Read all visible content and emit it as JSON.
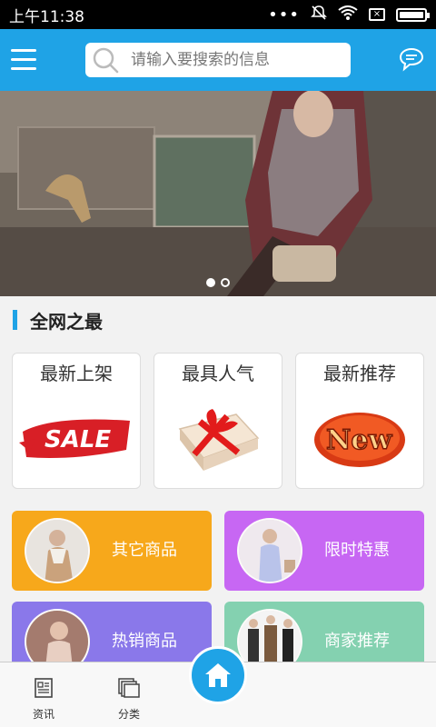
{
  "status_bar": {
    "time": "上午11:38",
    "icons": [
      "dots-icon",
      "mute-icon",
      "wifi-icon",
      "sim-box-icon",
      "battery-icon"
    ]
  },
  "header": {
    "menu_icon": "hamburger-icon",
    "search_placeholder": "请输入要搜索的信息",
    "message_icon": "chat-bubble-icon",
    "accent_color": "#1fa3e6"
  },
  "banner": {
    "slide_count": 2,
    "active_slide": 1
  },
  "section": {
    "title": "全网之最"
  },
  "features": [
    {
      "label": "最新上架",
      "art": "SALE"
    },
    {
      "label": "最具人气",
      "art": "gift-box-icon"
    },
    {
      "label": "最新推荐",
      "art": "New"
    }
  ],
  "categories": [
    {
      "label": "其它商品",
      "color": "#f7a81b"
    },
    {
      "label": "限时特惠",
      "color": "#c767f3"
    },
    {
      "label": "热销商品",
      "color": "#8a78ea"
    },
    {
      "label": "商家推荐",
      "color": "#84d1b0"
    }
  ],
  "bottom_nav": {
    "items": [
      {
        "label": "资讯",
        "icon": "news-icon"
      },
      {
        "label": "分类",
        "icon": "category-icon"
      }
    ],
    "home_icon": "home-icon"
  }
}
